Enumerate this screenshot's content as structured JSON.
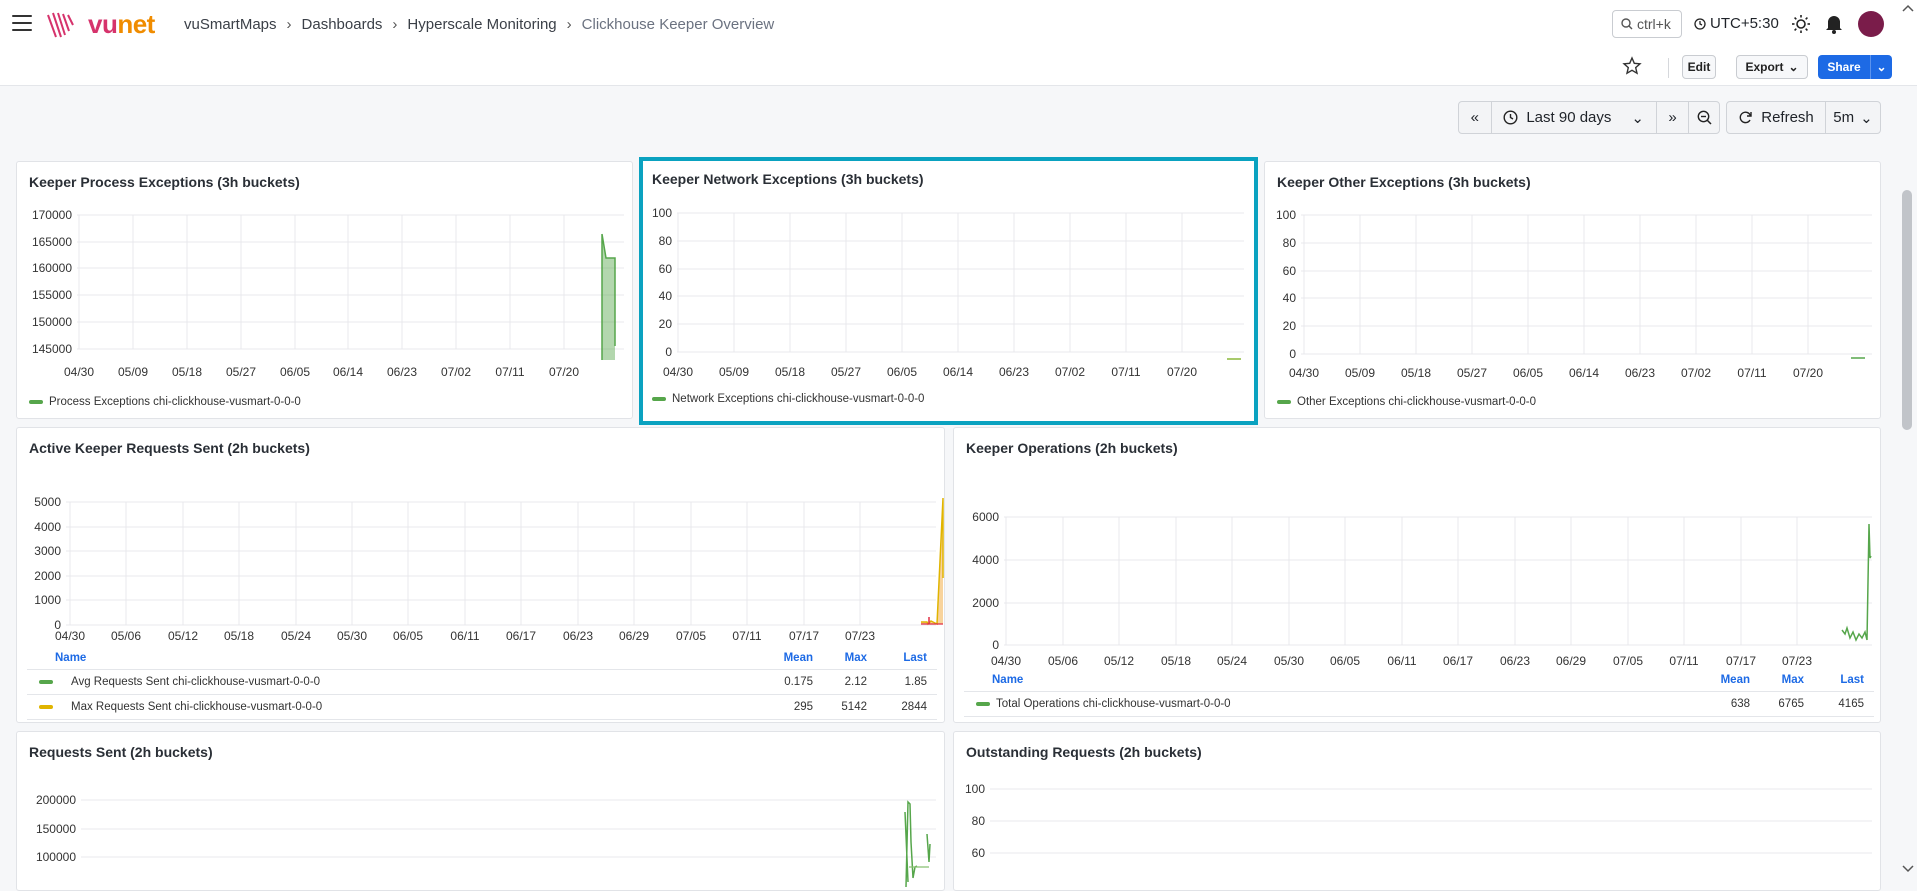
{
  "brand": {
    "vu": "vu",
    "net": "net"
  },
  "breadcrumbs": [
    "vuSmartMaps",
    "Dashboards",
    "Hyperscale Monitoring",
    "Clickhouse Keeper Overview"
  ],
  "search": {
    "shortcut": "ctrl+k"
  },
  "timezone": "UTC+5:30",
  "toolbar": {
    "edit": "Edit",
    "export": "Export",
    "share": "Share"
  },
  "timepicker": {
    "range": "Last 90 days",
    "refresh": "Refresh",
    "interval": "5m"
  },
  "colors": {
    "green": "#56a64b",
    "yellow": "#e0b400",
    "red": "#e02f44",
    "highlight": "#0aa2c0",
    "accent": "#1d6ae5"
  },
  "panels": [
    {
      "title": "Keeper Process Exceptions (3h buckets)",
      "yticks": [
        "170000",
        "165000",
        "160000",
        "155000",
        "150000",
        "145000"
      ],
      "xticks": [
        "04/30",
        "05/09",
        "05/18",
        "05/27",
        "06/05",
        "06/14",
        "06/23",
        "07/02",
        "07/11",
        "07/20"
      ],
      "legend": "Process Exceptions chi-clickhouse-vusmart-0-0-0"
    },
    {
      "title": "Keeper Network Exceptions (3h buckets)",
      "yticks": [
        "100",
        "80",
        "60",
        "40",
        "20",
        "0"
      ],
      "xticks": [
        "04/30",
        "05/09",
        "05/18",
        "05/27",
        "06/05",
        "06/14",
        "06/23",
        "07/02",
        "07/11",
        "07/20"
      ],
      "legend": "Network Exceptions chi-clickhouse-vusmart-0-0-0"
    },
    {
      "title": "Keeper Other Exceptions (3h buckets)",
      "yticks": [
        "100",
        "80",
        "60",
        "40",
        "20",
        "0"
      ],
      "xticks": [
        "04/30",
        "05/09",
        "05/18",
        "05/27",
        "06/05",
        "06/14",
        "06/23",
        "07/02",
        "07/11",
        "07/20"
      ],
      "legend": "Other Exceptions chi-clickhouse-vusmart-0-0-0"
    },
    {
      "title": "Active Keeper Requests Sent (2h buckets)",
      "yticks": [
        "5000",
        "4000",
        "3000",
        "2000",
        "1000",
        "0"
      ],
      "xticks": [
        "04/30",
        "05/06",
        "05/12",
        "05/18",
        "05/24",
        "05/30",
        "06/05",
        "06/11",
        "06/17",
        "06/23",
        "06/29",
        "07/05",
        "07/11",
        "07/17",
        "07/23"
      ],
      "table": {
        "headers": {
          "name": "Name",
          "mean": "Mean",
          "max": "Max",
          "last": "Last"
        },
        "rows": [
          {
            "name": "Avg Requests Sent chi-clickhouse-vusmart-0-0-0",
            "mean": "0.175",
            "max": "2.12",
            "last": "1.85"
          },
          {
            "name": "Max Requests Sent chi-clickhouse-vusmart-0-0-0",
            "mean": "295",
            "max": "5142",
            "last": "2844"
          }
        ]
      }
    },
    {
      "title": "Keeper Operations (2h buckets)",
      "yticks": [
        "6000",
        "4000",
        "2000",
        "0"
      ],
      "xticks": [
        "04/30",
        "05/06",
        "05/12",
        "05/18",
        "05/24",
        "05/30",
        "06/05",
        "06/11",
        "06/17",
        "06/23",
        "06/29",
        "07/05",
        "07/11",
        "07/17",
        "07/23"
      ],
      "table": {
        "headers": {
          "name": "Name",
          "mean": "Mean",
          "max": "Max",
          "last": "Last"
        },
        "rows": [
          {
            "name": "Total Operations chi-clickhouse-vusmart-0-0-0",
            "mean": "638",
            "max": "6765",
            "last": "4165"
          }
        ]
      }
    },
    {
      "title": "Requests Sent (2h buckets)",
      "yticks": [
        "200000",
        "150000",
        "100000"
      ]
    },
    {
      "title": "Outstanding Requests (2h buckets)",
      "yticks": [
        "100",
        "80",
        "60"
      ]
    }
  ]
}
